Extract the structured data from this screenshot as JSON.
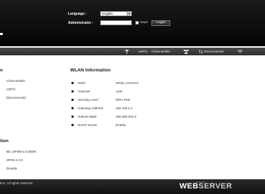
{
  "header": {
    "language_label": "Language :",
    "language_value": "English",
    "admin_label": "Administrator :",
    "password_value": "",
    "save_label": "Save",
    "login_label": "Login"
  },
  "statusbar": {
    "network_type": "UMTS",
    "carrier": "China Mobile",
    "connection_status": "Disconnected"
  },
  "left_info": {
    "title": "n",
    "rows": [
      "China Mobile",
      "UMTS",
      "Disconnected"
    ]
  },
  "wlan": {
    "title": "WLAN Information",
    "rows": [
      {
        "label": "SSID",
        "value": "MF65_XXXXXX"
      },
      {
        "label": "Channel",
        "value": "Auto"
      },
      {
        "label": "Security Level",
        "value": "WPA-PSK"
      },
      {
        "label": "Gateway Address",
        "value": "192.168.0.1"
      },
      {
        "label": "Subnet Mask",
        "value": "255.255.255.0"
      },
      {
        "label": "DHCP Server",
        "value": "Enable"
      }
    ]
  },
  "version": {
    "title": "tion",
    "rows": [
      "BD_MF65V1.0.0B09",
      "MF65-1.0.0",
      "Disable"
    ]
  },
  "footer": {
    "copyright": "tion. All rights reserved",
    "brand_small": "powered",
    "brand_part1": "WEB",
    "brand_part2": "SERVER"
  },
  "colors": {
    "header_bg": "#0d0d0d",
    "statusbar_bg": "#3a3a3a",
    "footer_bg": "#1a1a1a"
  }
}
